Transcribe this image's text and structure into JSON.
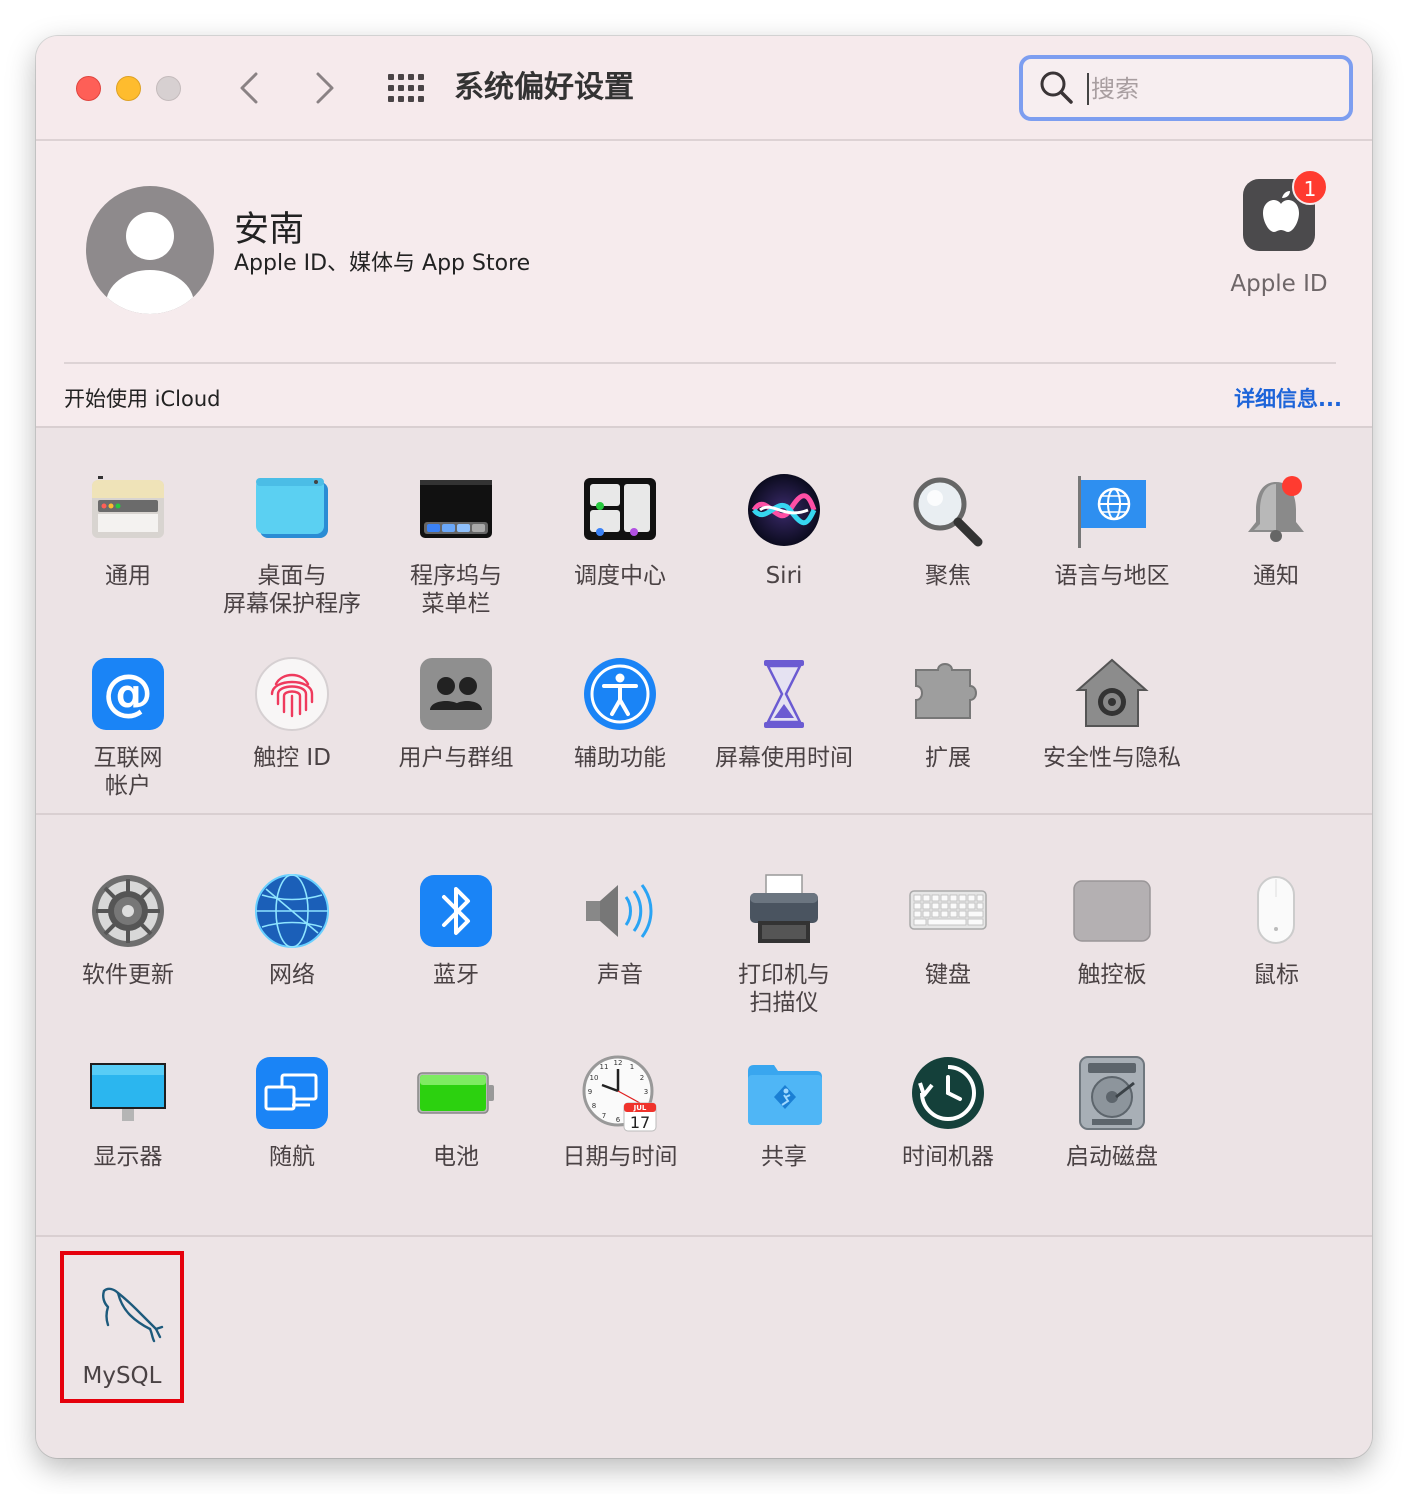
{
  "window": {
    "title": "系统偏好设置",
    "search_placeholder": "搜索"
  },
  "account": {
    "name": "安南",
    "subtitle": "Apple ID、媒体与 App Store",
    "apple_id_label": "Apple ID",
    "badge_count": "1",
    "icloud_text": "开始使用 iCloud",
    "icloud_link": "详细信息..."
  },
  "panes_row1": [
    {
      "label": "通用",
      "icon": "general-icon"
    },
    {
      "label": "桌面与\n屏幕保护程序",
      "icon": "desktop-screensaver-icon"
    },
    {
      "label": "程序坞与\n菜单栏",
      "icon": "dock-menubar-icon"
    },
    {
      "label": "调度中心",
      "icon": "mission-control-icon"
    },
    {
      "label": "Siri",
      "icon": "siri-icon"
    },
    {
      "label": "聚焦",
      "icon": "spotlight-icon"
    },
    {
      "label": "语言与地区",
      "icon": "language-region-icon"
    },
    {
      "label": "通知",
      "icon": "notifications-icon"
    }
  ],
  "panes_row2": [
    {
      "label": "互联网\n帐户",
      "icon": "internet-accounts-icon"
    },
    {
      "label": "触控 ID",
      "icon": "touch-id-icon"
    },
    {
      "label": "用户与群组",
      "icon": "users-groups-icon"
    },
    {
      "label": "辅助功能",
      "icon": "accessibility-icon"
    },
    {
      "label": "屏幕使用时间",
      "icon": "screen-time-icon"
    },
    {
      "label": "扩展",
      "icon": "extensions-icon"
    },
    {
      "label": "安全性与隐私",
      "icon": "security-privacy-icon"
    }
  ],
  "panes_row3": [
    {
      "label": "软件更新",
      "icon": "software-update-icon"
    },
    {
      "label": "网络",
      "icon": "network-icon"
    },
    {
      "label": "蓝牙",
      "icon": "bluetooth-icon"
    },
    {
      "label": "声音",
      "icon": "sound-icon"
    },
    {
      "label": "打印机与\n扫描仪",
      "icon": "printers-scanners-icon"
    },
    {
      "label": "键盘",
      "icon": "keyboard-icon"
    },
    {
      "label": "触控板",
      "icon": "trackpad-icon"
    },
    {
      "label": "鼠标",
      "icon": "mouse-icon"
    }
  ],
  "panes_row4": [
    {
      "label": "显示器",
      "icon": "displays-icon"
    },
    {
      "label": "随航",
      "icon": "sidecar-icon"
    },
    {
      "label": "电池",
      "icon": "battery-icon"
    },
    {
      "label": "日期与时间",
      "icon": "date-time-icon"
    },
    {
      "label": "共享",
      "icon": "sharing-icon"
    },
    {
      "label": "时间机器",
      "icon": "time-machine-icon"
    },
    {
      "label": "启动磁盘",
      "icon": "startup-disk-icon"
    }
  ],
  "date_icon": {
    "month": "JUL",
    "day": "17"
  },
  "third_party": [
    {
      "label": "MySQL",
      "icon": "mysql-icon"
    }
  ],
  "colors": {
    "highlight_box": "#e5000c",
    "link": "#1d64d9",
    "search_focus": "#7d9ef0"
  }
}
